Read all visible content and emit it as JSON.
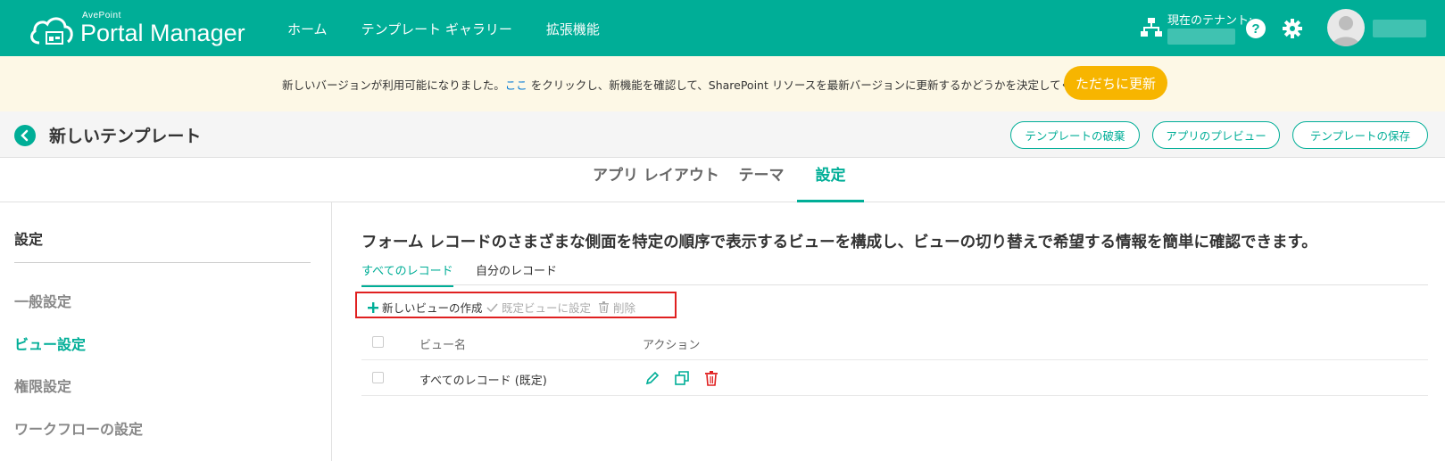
{
  "topbar": {
    "brand_small": "AvePoint",
    "brand_title": "Portal Manager",
    "nav": [
      "ホーム",
      "テンプレート ギャラリー",
      "拡張機能"
    ],
    "tenant_label": "現在のテナント:",
    "icons": {
      "tenant": "org-chart-icon",
      "help": "help-icon",
      "settings": "gear-icon",
      "avatar": "user-avatar-icon"
    }
  },
  "notice": {
    "text_before": "新しいバージョンが利用可能になりました。",
    "link": "ここ",
    "text_after": " をクリックし、新機能を確認して、SharePoint リソースを最新バージョンに更新するかどうかを決定してください。",
    "button": "ただちに更新"
  },
  "page_header": {
    "title": "新しいテンプレート",
    "buttons": [
      "テンプレートの破棄",
      "アプリのプレビュー",
      "テンプレートの保存"
    ]
  },
  "tabs": {
    "items": [
      "アプリ レイアウト",
      "テーマ",
      "設定"
    ],
    "active": "設定"
  },
  "sidebar": {
    "heading": "設定",
    "items": [
      "一般設定",
      "ビュー設定",
      "権限設定",
      "ワークフローの設定"
    ],
    "active": "ビュー設定"
  },
  "main": {
    "description": "フォーム レコードのさまざまな側面を特定の順序で表示するビューを構成し、ビューの切り替えで希望する情報を簡単に確認できます。",
    "subtabs": [
      "すべてのレコード",
      "自分のレコード"
    ],
    "active_subtab": "すべてのレコード",
    "toolbar": {
      "new_view": "新しいビューの作成",
      "set_default": "既定ビューに設定",
      "delete": "削除"
    },
    "table": {
      "columns": [
        "ビュー名",
        "アクション"
      ],
      "rows": [
        {
          "name": "すべてのレコード (既定)",
          "actions": [
            "edit-icon",
            "copy-icon",
            "delete-icon"
          ]
        }
      ]
    }
  },
  "colors": {
    "accent": "#00ae97",
    "warning": "#f7b500",
    "danger": "#e02020",
    "notice_bg": "#fdf8e6"
  }
}
